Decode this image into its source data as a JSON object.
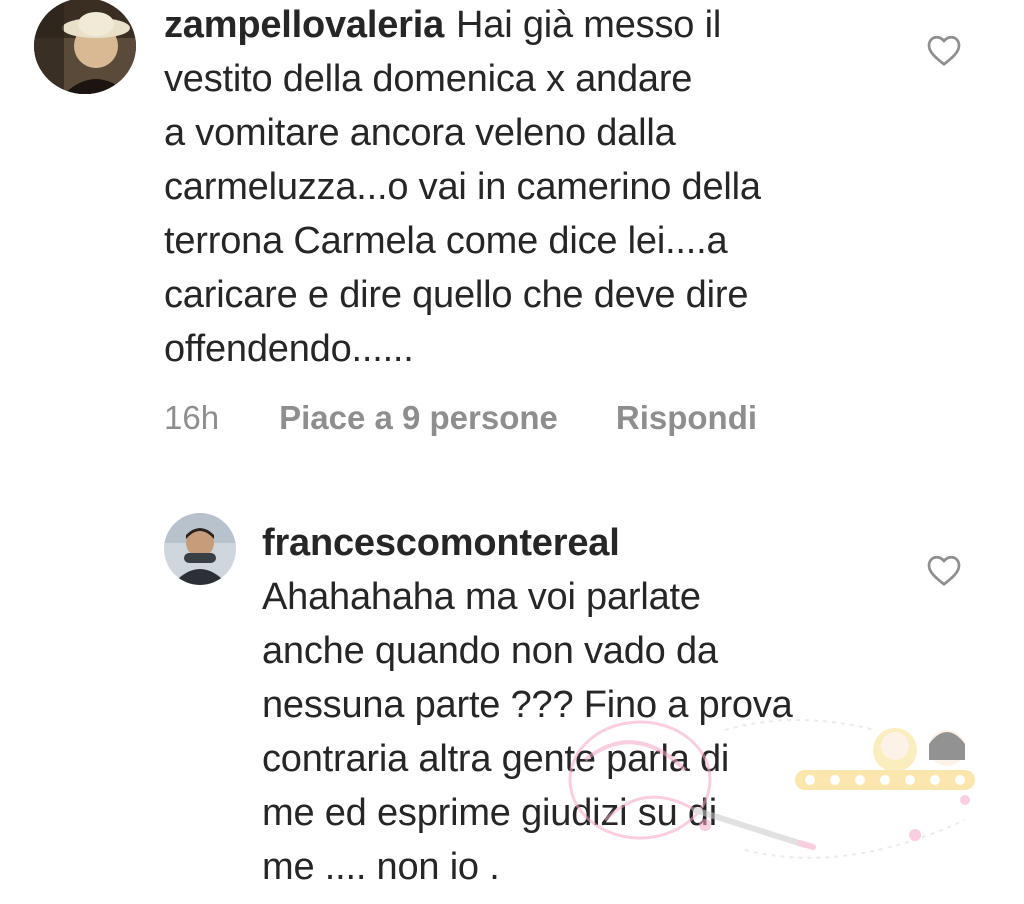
{
  "comments": [
    {
      "username": "zampellovaleria",
      "text": "Hai già messo il\nvestito della domenica x andare\na vomitare ancora veleno dalla\ncarmeluzza...o vai in camerino della\nterrona Carmela come dice lei....a\ncaricare e dire quello che deve dire\noffendendo......",
      "time": "16h",
      "likes": "Piace a 9 persone",
      "reply_label": "Rispondi",
      "like_icon": "heart-outline-icon"
    },
    {
      "username": "francescomontereal",
      "text": "Ahahahaha ma voi parlate\nanche quando non vado da\nnessuna parte ??? Fino a prova\ncontraria altra gente parla di\nme ed esprime giudizi su di\nme .... non io .",
      "like_icon": "heart-outline-icon"
    }
  ],
  "colors": {
    "text": "#262626",
    "secondary": "#8e8e8e",
    "heart_stroke": "#8e8e8e",
    "watermark_pink": "#f4a7c8"
  }
}
